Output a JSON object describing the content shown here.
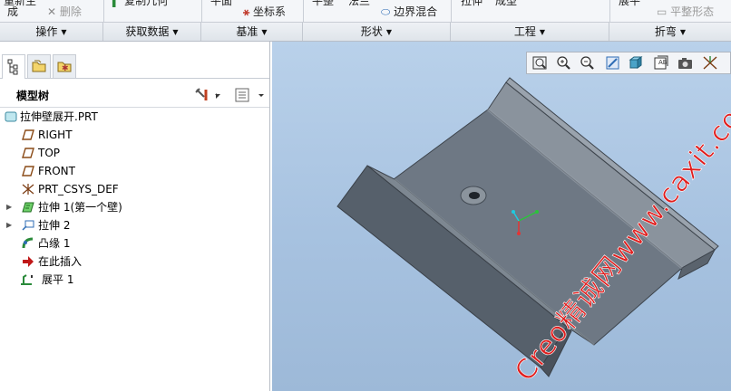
{
  "ribbon": {
    "top_items": {
      "regenerate": "重新生",
      "regenerate_line2": "成",
      "delete": "删除",
      "copy_geometry": "复制几何",
      "plane": "平面",
      "coordinate_system": "坐标系",
      "flat": "平整",
      "flange": "法兰",
      "boundary_blend": "边界混合",
      "extrude": "拉伸",
      "form": "成型",
      "unbend": "展平",
      "flat_state": "平整形态"
    },
    "groups": [
      {
        "label": "操作"
      },
      {
        "label": "获取数据"
      },
      {
        "label": "基准"
      },
      {
        "label": "形状"
      },
      {
        "label": "工程"
      },
      {
        "label": "折弯"
      }
    ]
  },
  "model_tree": {
    "title": "模型树",
    "items": [
      {
        "label": "拉伸壁展开.PRT",
        "icon": "part-icon"
      },
      {
        "label": "RIGHT",
        "icon": "datum-plane-icon"
      },
      {
        "label": "TOP",
        "icon": "datum-plane-icon"
      },
      {
        "label": "FRONT",
        "icon": "datum-plane-icon"
      },
      {
        "label": "PRT_CSYS_DEF",
        "icon": "coordinate-system-icon"
      },
      {
        "label": "拉伸 1(第一个壁)",
        "icon": "extrude-wall-icon",
        "expandable": true
      },
      {
        "label": "拉伸 2",
        "icon": "extrude-cut-icon",
        "expandable": true
      },
      {
        "label": "凸缘 1",
        "icon": "flange-icon"
      },
      {
        "label": "在此插入",
        "icon": "insert-here-arrow-icon"
      },
      {
        "label": "展平 1",
        "icon": "unbend-icon"
      }
    ]
  },
  "watermark": {
    "text": "Creo精诚网www.caxit.com"
  },
  "colors": {
    "viewport_top": "#b9d1ea",
    "viewport_bottom": "#9db9d8",
    "part_surface": "#6e7884",
    "watermark": "#e01e1e"
  }
}
